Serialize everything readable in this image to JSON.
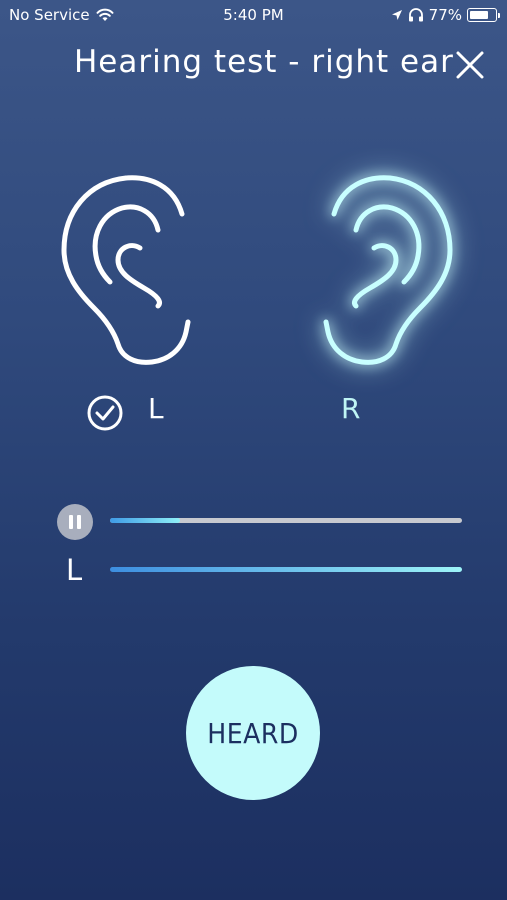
{
  "status_bar": {
    "carrier": "No Service",
    "time": "5:40 PM",
    "battery_percent": "77%",
    "battery_level": 0.77,
    "icons": [
      "wifi-icon",
      "location-arrow-icon",
      "headphones-icon",
      "battery-icon"
    ]
  },
  "header": {
    "title": "Hearing test - right ear",
    "close_icon": "close-icon"
  },
  "ears": {
    "left_label": "L",
    "left_completed": true,
    "right_label": "R",
    "right_active": true
  },
  "playback": {
    "progress": 0.2,
    "level_label": "L",
    "level": 1.0
  },
  "action": {
    "heard_label": "HEARD"
  },
  "colors": {
    "accent": "#c4fbfb",
    "glow": "#bff5f5",
    "background_top": "#3c5688",
    "background_bottom": "#1c2f60"
  }
}
